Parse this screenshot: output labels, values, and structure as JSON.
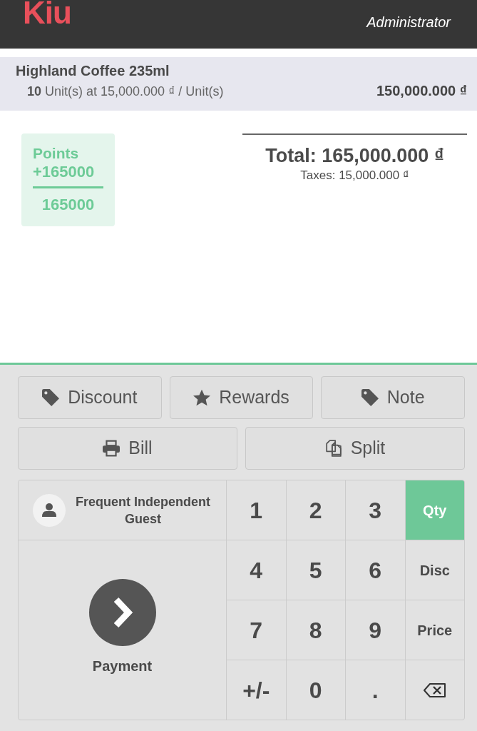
{
  "header": {
    "logo": "Kiu",
    "user": "Administrator"
  },
  "orderline": {
    "selected": true,
    "product": "Highland Coffee 235ml",
    "detail": "**10** Unit(s) at 15,000.000 ₫ / Unit(s)",
    "price": "150,000.000 ₫"
  },
  "points": {
    "label": "Points",
    "earned": "+165000",
    "total": "165000"
  },
  "summary": {
    "total": "Total: 165,000.000 ₫",
    "taxes": "Taxes: 15,000.000 ₫"
  },
  "action_rows": [
    {
      "buttons": [
        {
          "kind": "discount",
          "label": "Discount"
        },
        {
          "kind": "rewards",
          "label": "Rewards"
        },
        {
          "kind": "note",
          "label": "Note"
        }
      ]
    },
    {
      "buttons": [
        {
          "kind": "bill",
          "label": "Bill"
        },
        {
          "kind": "split",
          "label": "Split"
        }
      ]
    }
  ],
  "customer": {
    "name": "Frequent Independent Guest"
  },
  "payment": {
    "label": "Payment"
  },
  "numpad": {
    "rows": [
      [
        {
          "kind": "digit",
          "label": "1"
        },
        {
          "kind": "digit",
          "label": "2"
        },
        {
          "kind": "digit",
          "label": "3"
        },
        {
          "kind": "mode",
          "label": "Qty",
          "selected": true
        }
      ],
      [
        {
          "kind": "digit",
          "label": "4"
        },
        {
          "kind": "digit",
          "label": "5"
        },
        {
          "kind": "digit",
          "label": "6"
        },
        {
          "kind": "mode",
          "label": "Disc",
          "selected": false
        }
      ],
      [
        {
          "kind": "digit",
          "label": "7"
        },
        {
          "kind": "digit",
          "label": "8"
        },
        {
          "kind": "digit",
          "label": "9"
        },
        {
          "kind": "mode",
          "label": "Price",
          "selected": false
        }
      ],
      [
        {
          "kind": "digit",
          "label": "+/-"
        },
        {
          "kind": "digit",
          "label": "0"
        },
        {
          "kind": "digit",
          "label": "."
        },
        {
          "kind": "backspace"
        }
      ]
    ]
  }
}
